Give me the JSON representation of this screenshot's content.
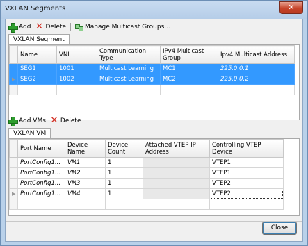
{
  "window": {
    "title": "VXLAN Segments",
    "close_glyph": "✕"
  },
  "segments_toolbar": {
    "add_label": "Add",
    "delete_label": "Delete",
    "manage_label": "Manage Multicast Groups..."
  },
  "segments_tab": {
    "label": "VXLAN Segment"
  },
  "segments_table": {
    "columns": [
      "Name",
      "VNI",
      "Communication Type",
      "IPv4 Multicast Group",
      "Ipv4 Multicast Address"
    ],
    "rows": [
      {
        "name": "SEG1",
        "vni": "1001",
        "type": "Multicast Learning",
        "group": "MC1",
        "address": "225.0.0.1"
      },
      {
        "name": "SEG2",
        "vni": "1002",
        "type": "Multicast Learning",
        "group": "MC2",
        "address": "225.0.0.2"
      }
    ]
  },
  "vm_toolbar": {
    "add_label": "Add VMs",
    "delete_label": "Delete"
  },
  "vm_tab": {
    "label": "VXLAN VM"
  },
  "vm_table": {
    "columns": [
      "Port Name",
      "Device Name",
      "Device Count",
      "Attached VTEP IP Address",
      "Controlling VTEP Device"
    ],
    "rows": [
      {
        "port": "PortConfig1...",
        "device": "VM1",
        "count": "1",
        "vtep_ip": "",
        "vtep": "VTEP1"
      },
      {
        "port": "PortConfig1...",
        "device": "VM2",
        "count": "1",
        "vtep_ip": "",
        "vtep": "VTEP1"
      },
      {
        "port": "PortConfig1...",
        "device": "VM3",
        "count": "1",
        "vtep_ip": "",
        "vtep": "VTEP2"
      },
      {
        "port": "PortConfig1...",
        "device": "VM4",
        "count": "1",
        "vtep_ip": "",
        "vtep": "VTEP2"
      }
    ]
  },
  "footer": {
    "close_label": "Close"
  },
  "colors": {
    "selection": "#3399ff",
    "add_green": "#2e9e2e",
    "delete_red": "#d22a1e"
  },
  "icons": {
    "add": "plus-icon",
    "delete": "x-icon",
    "manage": "multicast-icon",
    "row_pointer": "triangle-right-icon"
  }
}
